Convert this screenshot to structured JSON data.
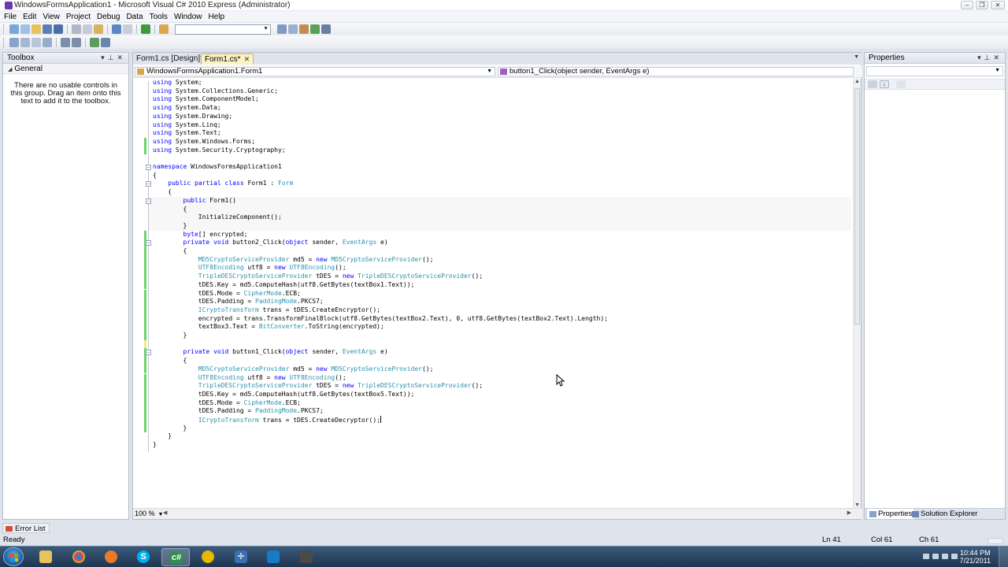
{
  "window": {
    "title": "WindowsFormsApplication1 - Microsoft Visual C# 2010 Express (Administrator)"
  },
  "menu": [
    "File",
    "Edit",
    "View",
    "Project",
    "Debug",
    "Data",
    "Tools",
    "Window",
    "Help"
  ],
  "toolbox": {
    "title": "Toolbox",
    "group": "General",
    "empty_message": "There are no usable controls in this group. Drag an item onto this text to add it to the toolbox."
  },
  "editor": {
    "tabs": [
      {
        "label": "Form1.cs [Design]*",
        "active": false
      },
      {
        "label": "Form1.cs*",
        "active": true
      }
    ],
    "nav_left": "WindowsFormsApplication1.Form1",
    "nav_right": "button1_Click(object sender, EventArgs e)",
    "zoom": "100 %",
    "code_lines": [
      "using System;",
      "using System.Collections.Generic;",
      "using System.ComponentModel;",
      "using System.Data;",
      "using System.Drawing;",
      "using System.Linq;",
      "using System.Text;",
      "using System.Windows.Forms;",
      "using System.Security.Cryptography;",
      "",
      "namespace WindowsFormsApplication1",
      "{",
      "    public partial class Form1 : Form",
      "    {",
      "        public Form1()",
      "        {",
      "            InitializeComponent();",
      "        }",
      "        byte[] encrypted;",
      "        private void button2_Click(object sender, EventArgs e)",
      "        {",
      "            MD5CryptoServiceProvider md5 = new MD5CryptoServiceProvider();",
      "            UTF8Encoding utf8 = new UTF8Encoding();",
      "            TripleDESCryptoServiceProvider tDES = new TripleDESCryptoServiceProvider();",
      "            tDES.Key = md5.ComputeHash(utf8.GetBytes(textBox1.Text));",
      "            tDES.Mode = CipherMode.ECB;",
      "            tDES.Padding = PaddingMode.PKCS7;",
      "            ICryptoTransform trans = tDES.CreateEncryptor();",
      "            encrypted = trans.TransformFinalBlock(utf8.GetBytes(textBox2.Text), 0, utf8.GetBytes(textBox2.Text).Length);",
      "            textBox3.Text = BitConverter.ToString(encrypted);",
      "        }",
      "",
      "        private void button1_Click(object sender, EventArgs e)",
      "        {",
      "            MD5CryptoServiceProvider md5 = new MD5CryptoServiceProvider();",
      "            UTF8Encoding utf8 = new UTF8Encoding();",
      "            TripleDESCryptoServiceProvider tDES = new TripleDESCryptoServiceProvider();",
      "            tDES.Key = md5.ComputeHash(utf8.GetBytes(textBox5.Text));",
      "            tDES.Mode = CipherMode.ECB;",
      "            tDES.Padding = PaddingMode.PKCS7;",
      "            ICryptoTransform trans = tDES.CreateDecryptor();",
      "        }",
      "    }",
      "}"
    ],
    "gutter_green": [
      7,
      8,
      18,
      19,
      20,
      21,
      22,
      23,
      24,
      25,
      26,
      27,
      28,
      29,
      30,
      32,
      33,
      34,
      35,
      36,
      37,
      38,
      39,
      40,
      41
    ],
    "gutter_yellow": [
      31
    ],
    "cursor_line": 40
  },
  "properties": {
    "title": "Properties",
    "bottom_tabs": [
      "Properties",
      "Solution Explorer"
    ]
  },
  "error_list": {
    "label": "Error List"
  },
  "status": {
    "ready": "Ready",
    "ln": "Ln 41",
    "col": "Col 61",
    "ch": "Ch 61"
  },
  "taskbar": {
    "time": "10:44 PM",
    "date": "7/21/2011"
  },
  "colors": {
    "keyword": "#0000ff",
    "type": "#2b91af",
    "active_tab": "#fbf3c5"
  }
}
